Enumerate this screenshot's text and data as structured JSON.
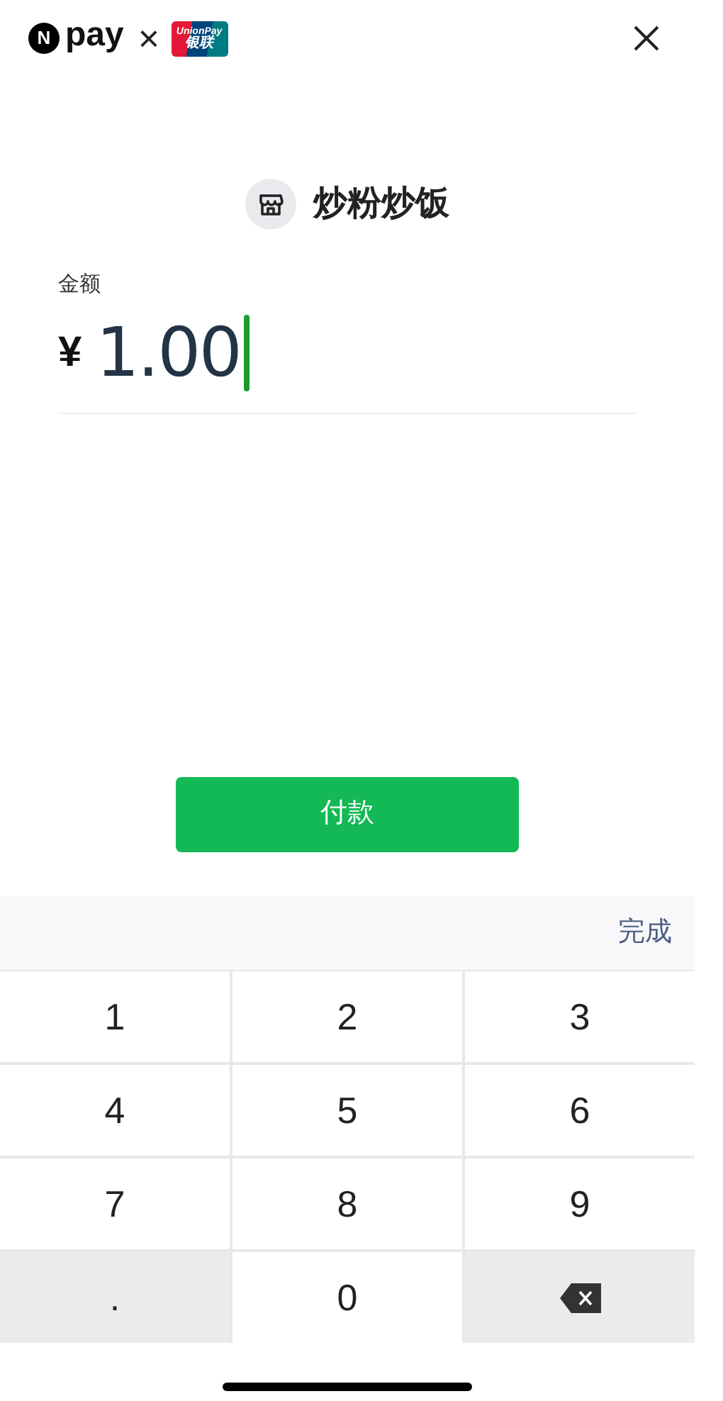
{
  "header": {
    "n_badge": "N",
    "brand": "pay",
    "times": "×",
    "unionpay_logo": {
      "latin": "UnionPay",
      "chinese": "银联"
    }
  },
  "merchant": {
    "name": "炒粉炒饭"
  },
  "amount": {
    "label": "金额",
    "currency": "¥",
    "value": "1.00"
  },
  "pay_button": "付款",
  "keyboard": {
    "done": "完成",
    "keys": [
      {
        "kind": "digit",
        "label": "1"
      },
      {
        "kind": "digit",
        "label": "2"
      },
      {
        "kind": "digit",
        "label": "3"
      },
      {
        "kind": "digit",
        "label": "4"
      },
      {
        "kind": "digit",
        "label": "5"
      },
      {
        "kind": "digit",
        "label": "6"
      },
      {
        "kind": "digit",
        "label": "7"
      },
      {
        "kind": "digit",
        "label": "8"
      },
      {
        "kind": "digit",
        "label": "9"
      },
      {
        "kind": "dot",
        "label": "."
      },
      {
        "kind": "digit",
        "label": "0"
      },
      {
        "kind": "backspace"
      }
    ]
  }
}
